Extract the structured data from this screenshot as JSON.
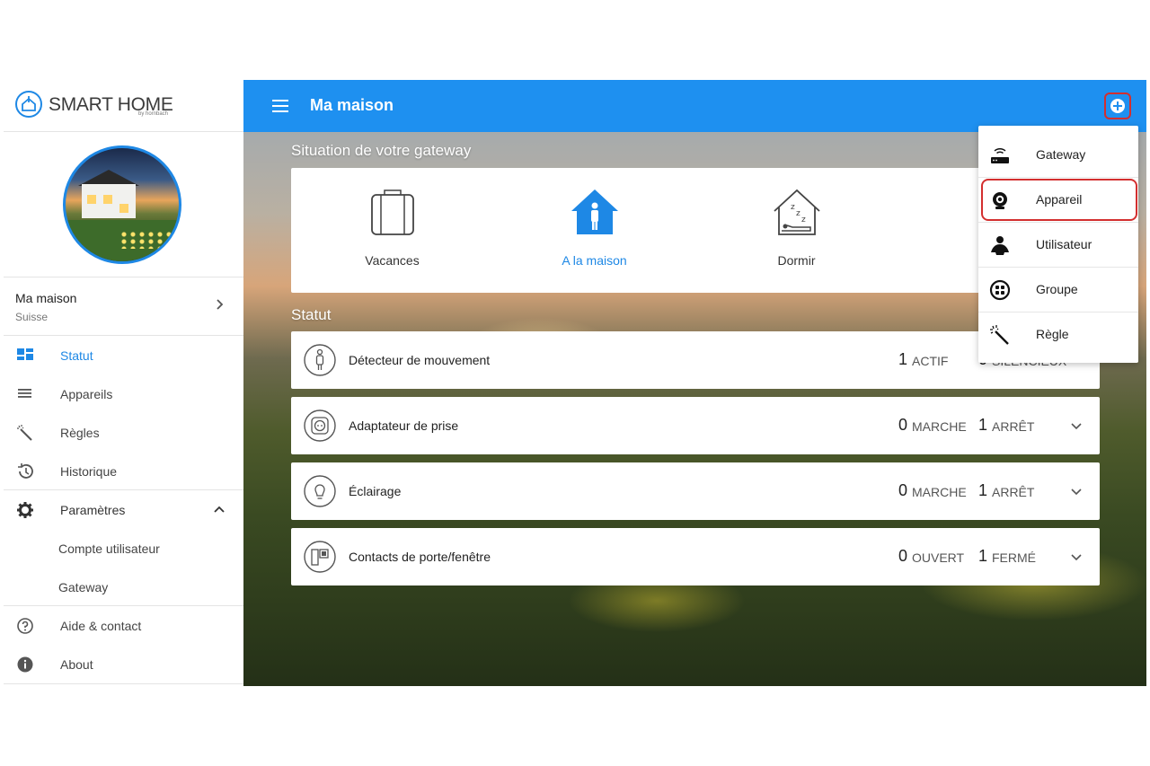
{
  "brand": {
    "name": "SMART HOME",
    "sub": "by hornbach"
  },
  "home": {
    "name": "Ma maison",
    "location": "Suisse"
  },
  "nav": {
    "statut": "Statut",
    "appareils": "Appareils",
    "regles": "Règles",
    "historique": "Historique",
    "parametres": "Paramètres",
    "compte": "Compte utilisateur",
    "gateway": "Gateway",
    "aide": "Aide & contact",
    "about": "About"
  },
  "topbar": {
    "title": "Ma maison"
  },
  "gateway_section": {
    "title": "Situation de votre gateway",
    "modes": [
      {
        "label": "Vacances",
        "icon": "suitcase-icon"
      },
      {
        "label": "A la maison",
        "icon": "home-person-icon",
        "active": true
      },
      {
        "label": "Dormir",
        "icon": "sleep-house-icon"
      }
    ]
  },
  "status_section": {
    "title": "Statut",
    "rows": [
      {
        "label": "Détecteur de mouvement",
        "a_num": "1",
        "a_unit": "ACTIF",
        "b_num": "0",
        "b_unit": "SILENCIEUX"
      },
      {
        "label": "Adaptateur de prise",
        "a_num": "0",
        "a_unit": "MARCHE",
        "b_num": "1",
        "b_unit": "ARRÊT"
      },
      {
        "label": "Éclairage",
        "a_num": "0",
        "a_unit": "MARCHE",
        "b_num": "1",
        "b_unit": "ARRÊT"
      },
      {
        "label": "Contacts de porte/fenêtre",
        "a_num": "0",
        "a_unit": "OUVERT",
        "b_num": "1",
        "b_unit": "FERMÉ"
      }
    ]
  },
  "dropdown": {
    "items": [
      {
        "label": "Gateway",
        "icon": "router-icon"
      },
      {
        "label": "Appareil",
        "icon": "camera-icon",
        "highlighted": true
      },
      {
        "label": "Utilisateur",
        "icon": "user-icon"
      },
      {
        "label": "Groupe",
        "icon": "group-icon"
      },
      {
        "label": "Règle",
        "icon": "magic-wand-icon"
      }
    ]
  },
  "colors": {
    "primary": "#1e90f0",
    "accent_text": "#1e88e5",
    "highlight": "#d32f2f"
  }
}
